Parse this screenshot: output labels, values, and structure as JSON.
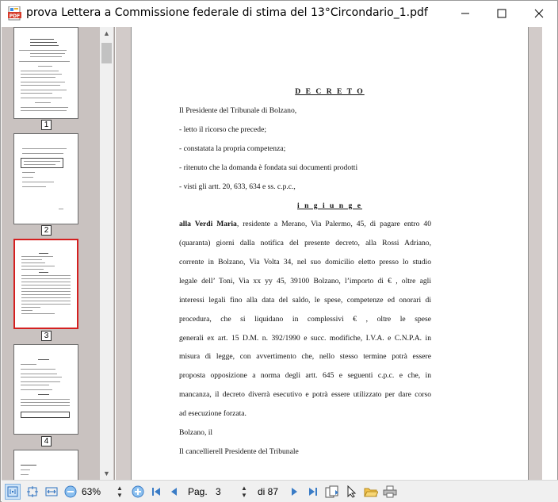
{
  "window": {
    "title": "prova Lettera a Commissione federale di stima del 13°Circondario_1.pdf",
    "app_icon": "pdf-icon"
  },
  "thumbnails": {
    "pages": [
      {
        "number": "1"
      },
      {
        "number": "2"
      },
      {
        "number": "3",
        "selected": true
      },
      {
        "number": "4"
      }
    ]
  },
  "document": {
    "heading": "D E C R E T O",
    "lines": [
      "Il Presidente del Tribunale di  Bolzano,",
      "- letto il ricorso che precede;",
      "- constatata la propria competenza;",
      "- ritenuto che la domanda è fondata sui documenti prodotti",
      "- visti gli artt. 20, 633, 634 e ss. c.p.c.,"
    ],
    "subheading": "i n g i u n g e",
    "para_name": "alla Verdi Maria",
    "para_lines": [
      ", residente a Merano, Via Palermo, 45, di pagare entro 40",
      "(quaranta) giorni dalla notifica del presente decreto, alla  Rossi Adriano,",
      "corrente in Bolzano, Via  Volta 34, nel suo domicilio eletto presso lo studio",
      "legale dell’ Toni, Via xx yy 45, 39100 Bolzano, l’importo di €  , oltre agli",
      "interessi legali fino alla data del saldo, le spese, competenze ed onorari di",
      "procedura, che si liquidano in complessivi €                     , oltre le spese",
      "generali ex art. 15 D.M. n. 392/1990 e succ. modifiche, I.V.A. e C.N.P.A. in",
      "misura di legge, con avvertimento che, nello stesso termine potrà essere",
      "proposta opposizione a norma degli artt. 645 e seguenti c.p.c. e che, in",
      "mancanza, il decreto diverrà esecutivo e potrà essere utilizzato per dare corso",
      "ad esecuzione forzata."
    ],
    "closing": [
      "Bolzano, il",
      "Il cancellierell Presidente del Tribunale"
    ]
  },
  "toolbar": {
    "zoom": "63%",
    "page_label": "Pag.",
    "page_value": "3",
    "total": "di 87"
  }
}
